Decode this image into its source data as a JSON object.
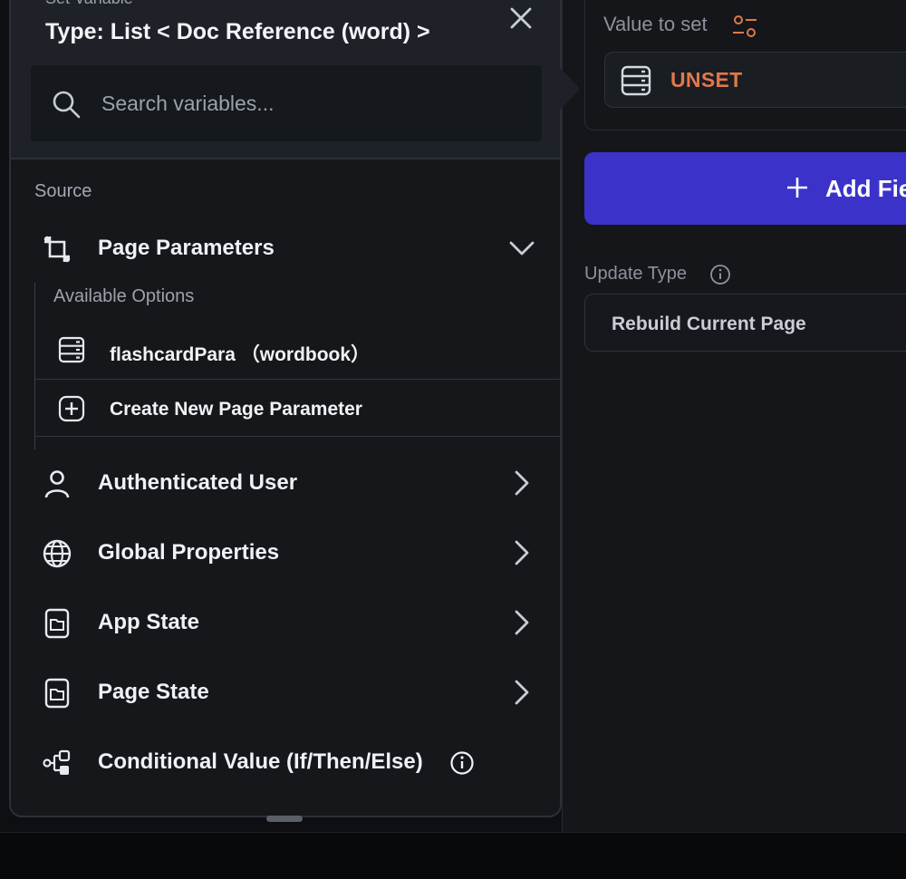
{
  "popup": {
    "subtitle": "Set Variable",
    "title": "Type: List < Doc Reference (word) >",
    "search_placeholder": "Search variables...",
    "source_label": "Source",
    "page_parameters": {
      "label": "Page Parameters",
      "available_options_label": "Available Options",
      "options": [
        {
          "label": "flashcardPara （wordbook）",
          "icon": "database-icon"
        },
        {
          "label": "Create New Page Parameter",
          "icon": "add-box-icon"
        }
      ]
    },
    "sources": [
      {
        "label": "Authenticated User",
        "icon": "person-icon"
      },
      {
        "label": "Global Properties",
        "icon": "globe-icon"
      },
      {
        "label": "App State",
        "icon": "app-state-icon"
      },
      {
        "label": "Page State",
        "icon": "page-state-icon"
      },
      {
        "label": "Conditional Value (If/Then/Else)",
        "icon": "conditional-icon"
      }
    ]
  },
  "editor": {
    "value_to_set_label": "Value to set",
    "value": "UNSET",
    "add_field_label": "Add Field",
    "update_type_label": "Update Type",
    "update_type_value": "Rebuild Current Page"
  },
  "colors": {
    "accent": "#3b33c9",
    "unset": "#e0784c",
    "panel": "#15171b",
    "header": "#1e2228"
  }
}
